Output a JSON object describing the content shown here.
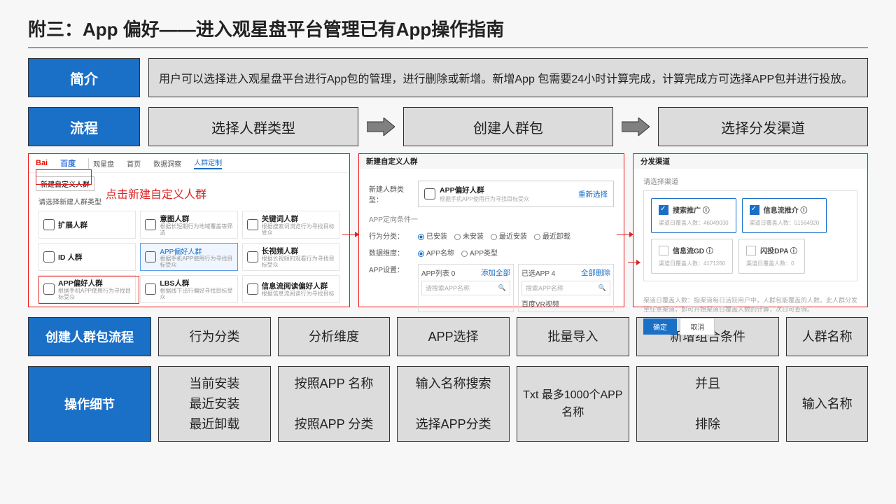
{
  "title": "附三：App 偏好——进入观星盘平台管理已有App操作指南",
  "intro_label": "简介",
  "intro_text": "用户可以选择进入观星盘平台进行App包的管理，进行删除或新增。新增App 包需要24小时计算完成，计算完成方可选择APP包并进行投放。",
  "flow_label": "流程",
  "flow_steps": [
    "选择人群类型",
    "创建人群包",
    "选择分发渠道"
  ],
  "shot1": {
    "brand": "Bai",
    "brand2": "百度",
    "brand3": "观星盘",
    "tabs": [
      "首页",
      "数据洞察",
      "人群定制"
    ],
    "new_btn": "新建自定义人群",
    "annot": "点击新建自定义人群",
    "filter_label": "请选择新建人群类型",
    "cells": [
      {
        "t": "扩展人群",
        "s": ""
      },
      {
        "t": "意图人群",
        "s": "根据长短期行为地域覆盖等筛选"
      },
      {
        "t": "关键词人群",
        "s": "根据搜索词浏览行为寻找目标受众"
      },
      {
        "t": "ID 人群",
        "s": ""
      },
      {
        "t": "APP偏好人群",
        "s": "根据手机APP使用行为寻找目标受众",
        "hl": true
      },
      {
        "t": "长视频人群",
        "s": "根据长视频的观看行为寻找目标受众"
      },
      {
        "t": "APP偏好人群",
        "s": "根据手机APP使用行为寻找目标受众"
      },
      {
        "t": "LBS人群",
        "s": "根据线下出行偏好寻找目标受众"
      },
      {
        "t": "信息流阅读偏好人群",
        "s": "根据信息流阅读行为寻找目标"
      }
    ]
  },
  "shot2": {
    "title": "新建自定义人群",
    "type_label": "新建人群类型：",
    "type_box_title": "APP偏好人群",
    "type_box_sub": "根据手机APP使用行为寻找目标受众",
    "reselect": "重新选择",
    "cond_label": "APP定向条件一",
    "row1_label": "行为分类：",
    "row1_opts": [
      "已安装",
      "未安装",
      "最近安装",
      "最近卸载"
    ],
    "row2_label": "数据维度：",
    "row2_opts": [
      "APP名称",
      "APP类型"
    ],
    "row3_label": "APP设置：",
    "list_title": "APP列表 0",
    "list_add": "添加全部",
    "sel_title": "已选APP 4",
    "sel_del": "全部删除",
    "search_ph": "请搜索APP名称",
    "sel_search_ph": "搜索APP名称",
    "sel_item": "百度VR视频"
  },
  "shot3": {
    "title": "分发渠道",
    "sub": "请选择渠道",
    "cards": [
      {
        "name": "搜索推广",
        "sub": "渠道日覆盖人数：46049030",
        "on": true
      },
      {
        "name": "信息流推介",
        "sub": "渠道日覆盖人数：51564920",
        "on": true
      },
      {
        "name": "信息流GD",
        "sub": "渠道日覆盖人数：4171260",
        "on": false
      },
      {
        "name": "闪投DPA",
        "sub": "渠道日覆盖人数：0",
        "on": false
      }
    ],
    "note": "渠道日覆盖人数：指渠道每日活跃用户中，人群包能覆盖的人数。此人群分发至任意渠道，即可开始渠道日覆盖人数的计算，次日可查询。",
    "btn_ok": "确定",
    "btn_cancel": "取消"
  },
  "table_header_label": "创建人群包流程",
  "table_headers": [
    "行为分类",
    "分析维度",
    "APP选择",
    "批量导入",
    "新增组合条件",
    "人群名称"
  ],
  "detail_label": "操作细节",
  "details": [
    "当前安装\n最近安装\n最近卸载",
    "按照APP 名称\n\n按照APP 分类",
    "输入名称搜索\n\n选择APP分类",
    "Txt 最多1000个APP名称",
    "并且\n\n排除",
    "输入名称"
  ]
}
